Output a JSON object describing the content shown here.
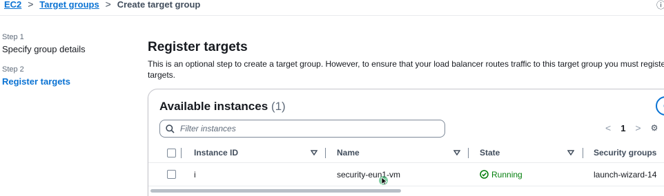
{
  "breadcrumb": {
    "items": [
      {
        "label": "EC2"
      },
      {
        "label": "Target groups"
      }
    ],
    "current": "Create target group",
    "separator": ">"
  },
  "steps": [
    {
      "label": "Step 1",
      "title": "Specify group details",
      "active": false
    },
    {
      "label": "Step 2",
      "title": "Register targets",
      "active": true
    }
  ],
  "main": {
    "title": "Register targets",
    "description": "This is an optional step to create a target group. However, to ensure that your load balancer routes traffic to this target group you must register targets."
  },
  "instances": {
    "header": "Available instances",
    "count": "(1)",
    "filter_placeholder": "Filter instances",
    "pagination": {
      "current_page": "1",
      "prev": "<",
      "next": ">"
    },
    "columns": [
      "Instance ID",
      "Name",
      "State",
      "Security groups"
    ],
    "rows": [
      {
        "instance_id": "i",
        "name": "security-eun1-vm",
        "state": "Running",
        "security_groups": "launch-wizard-14"
      }
    ]
  },
  "colors": {
    "link": "#0972d3",
    "running": "#037f0c",
    "text": "#16191f"
  }
}
